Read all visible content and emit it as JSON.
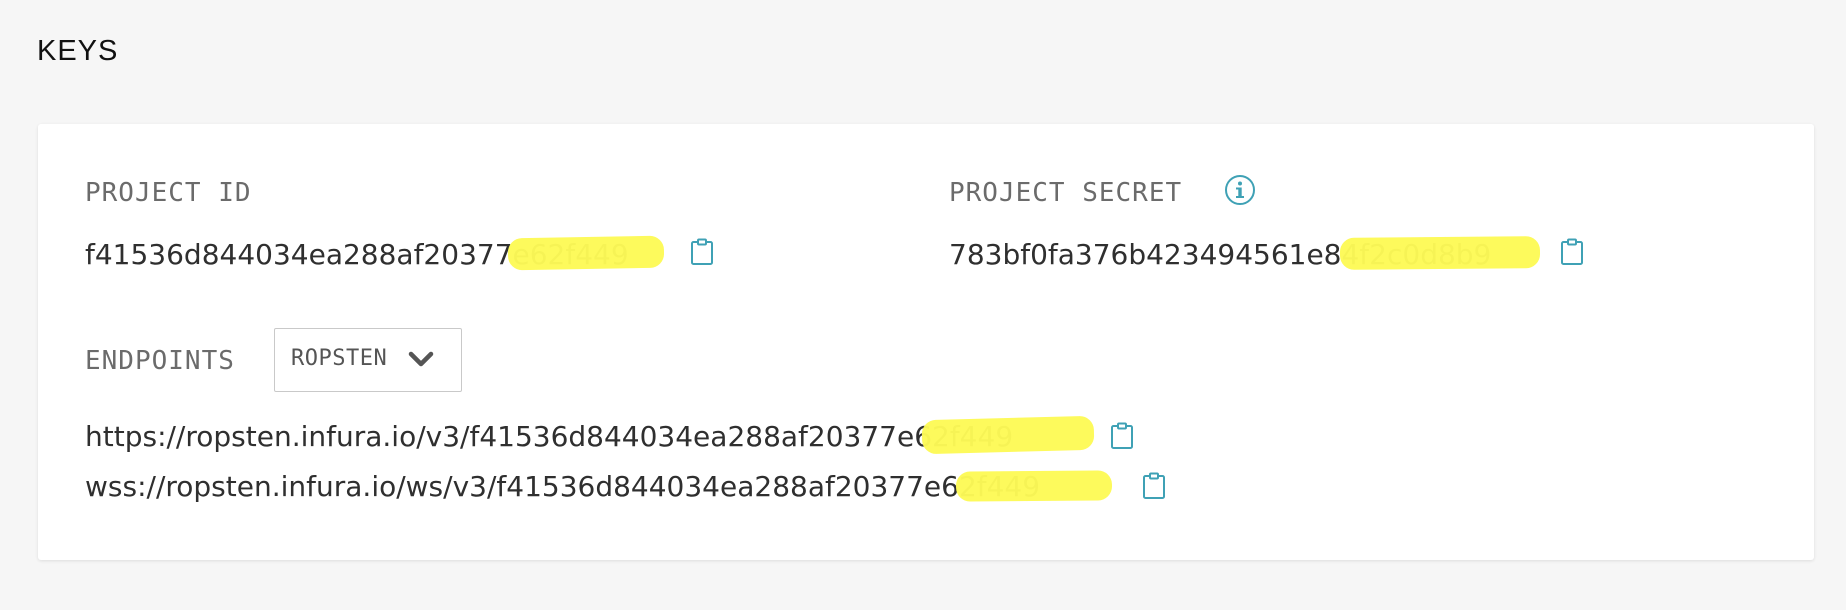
{
  "page": {
    "title": "KEYS"
  },
  "keys": {
    "project_id": {
      "label": "PROJECT ID",
      "value": "f41536d844034ea288af20377e62f449"
    },
    "project_secret": {
      "label": "PROJECT SECRET",
      "value": "783bf0fa376b423494561e84f2c0d8b9"
    }
  },
  "endpoints": {
    "label": "ENDPOINTS",
    "network_selected": "ROPSTEN",
    "https_url": "https://ropsten.infura.io/v3/f41536d844034ea288af20377e62f449",
    "wss_url": "wss://ropsten.infura.io/ws/v3/f41536d844034ea288af20377e62f449"
  },
  "icons": {
    "copy": "clipboard-icon",
    "info": "info-circle-icon",
    "dropdown": "chevron-down-icon"
  },
  "colors": {
    "accent": "#3fa1b5",
    "redaction": "#fdfa57",
    "background": "#f6f6f6",
    "card": "#ffffff"
  }
}
